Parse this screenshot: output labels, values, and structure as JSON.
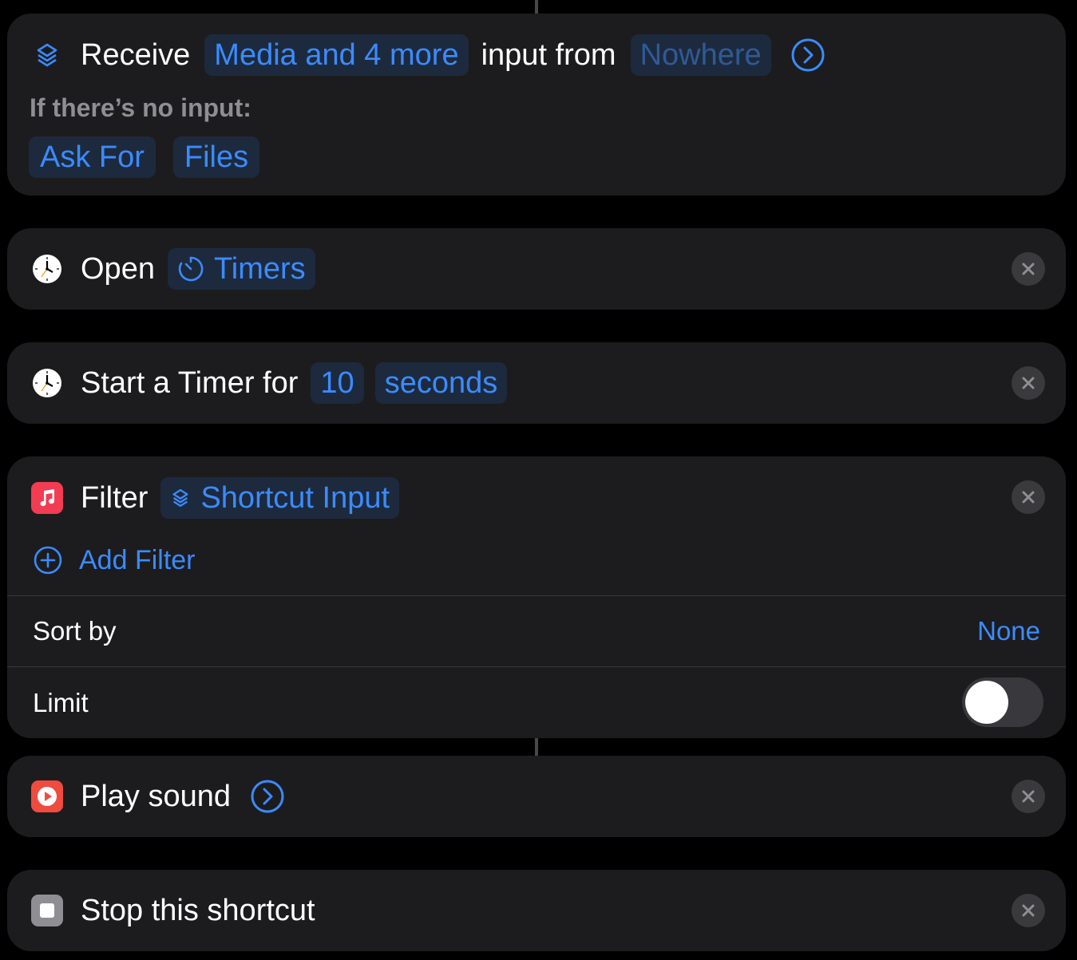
{
  "receive_action": {
    "verb": "Receive",
    "types_token": "Media and 4 more",
    "middle_text": "input from",
    "source_token": "Nowhere",
    "no_input_label": "If there’s no input:",
    "no_input_action": "Ask For",
    "no_input_type": "Files"
  },
  "open_action": {
    "verb": "Open",
    "app_token": "Timers"
  },
  "timer_action": {
    "label": "Start a Timer for",
    "amount": "10",
    "unit": "seconds"
  },
  "filter_action": {
    "verb": "Filter",
    "input_token": "Shortcut Input",
    "add_filter_label": "Add Filter",
    "sort_label": "Sort by",
    "sort_value": "None",
    "limit_label": "Limit",
    "limit_enabled": false
  },
  "play_sound_action": {
    "label": "Play sound"
  },
  "stop_action": {
    "label": "Stop this shortcut"
  },
  "icons": {
    "shortcut_input": "layers-icon",
    "clock_app": "clock-icon",
    "timer": "timer-icon",
    "music_app": "music-note-icon",
    "play_sound": "play-icon",
    "stop": "stop-icon",
    "expand": "chevron-right-circle-icon",
    "add": "plus-circle-icon",
    "remove": "close-icon"
  },
  "colors": {
    "background": "#000000",
    "card": "#1c1c1e",
    "accent": "#3b8bff",
    "token_bg": "#1d2a3d",
    "secondary_text": "#8e8e93",
    "music_red": "#f23c52",
    "sound_red": "#ef4b3f"
  }
}
